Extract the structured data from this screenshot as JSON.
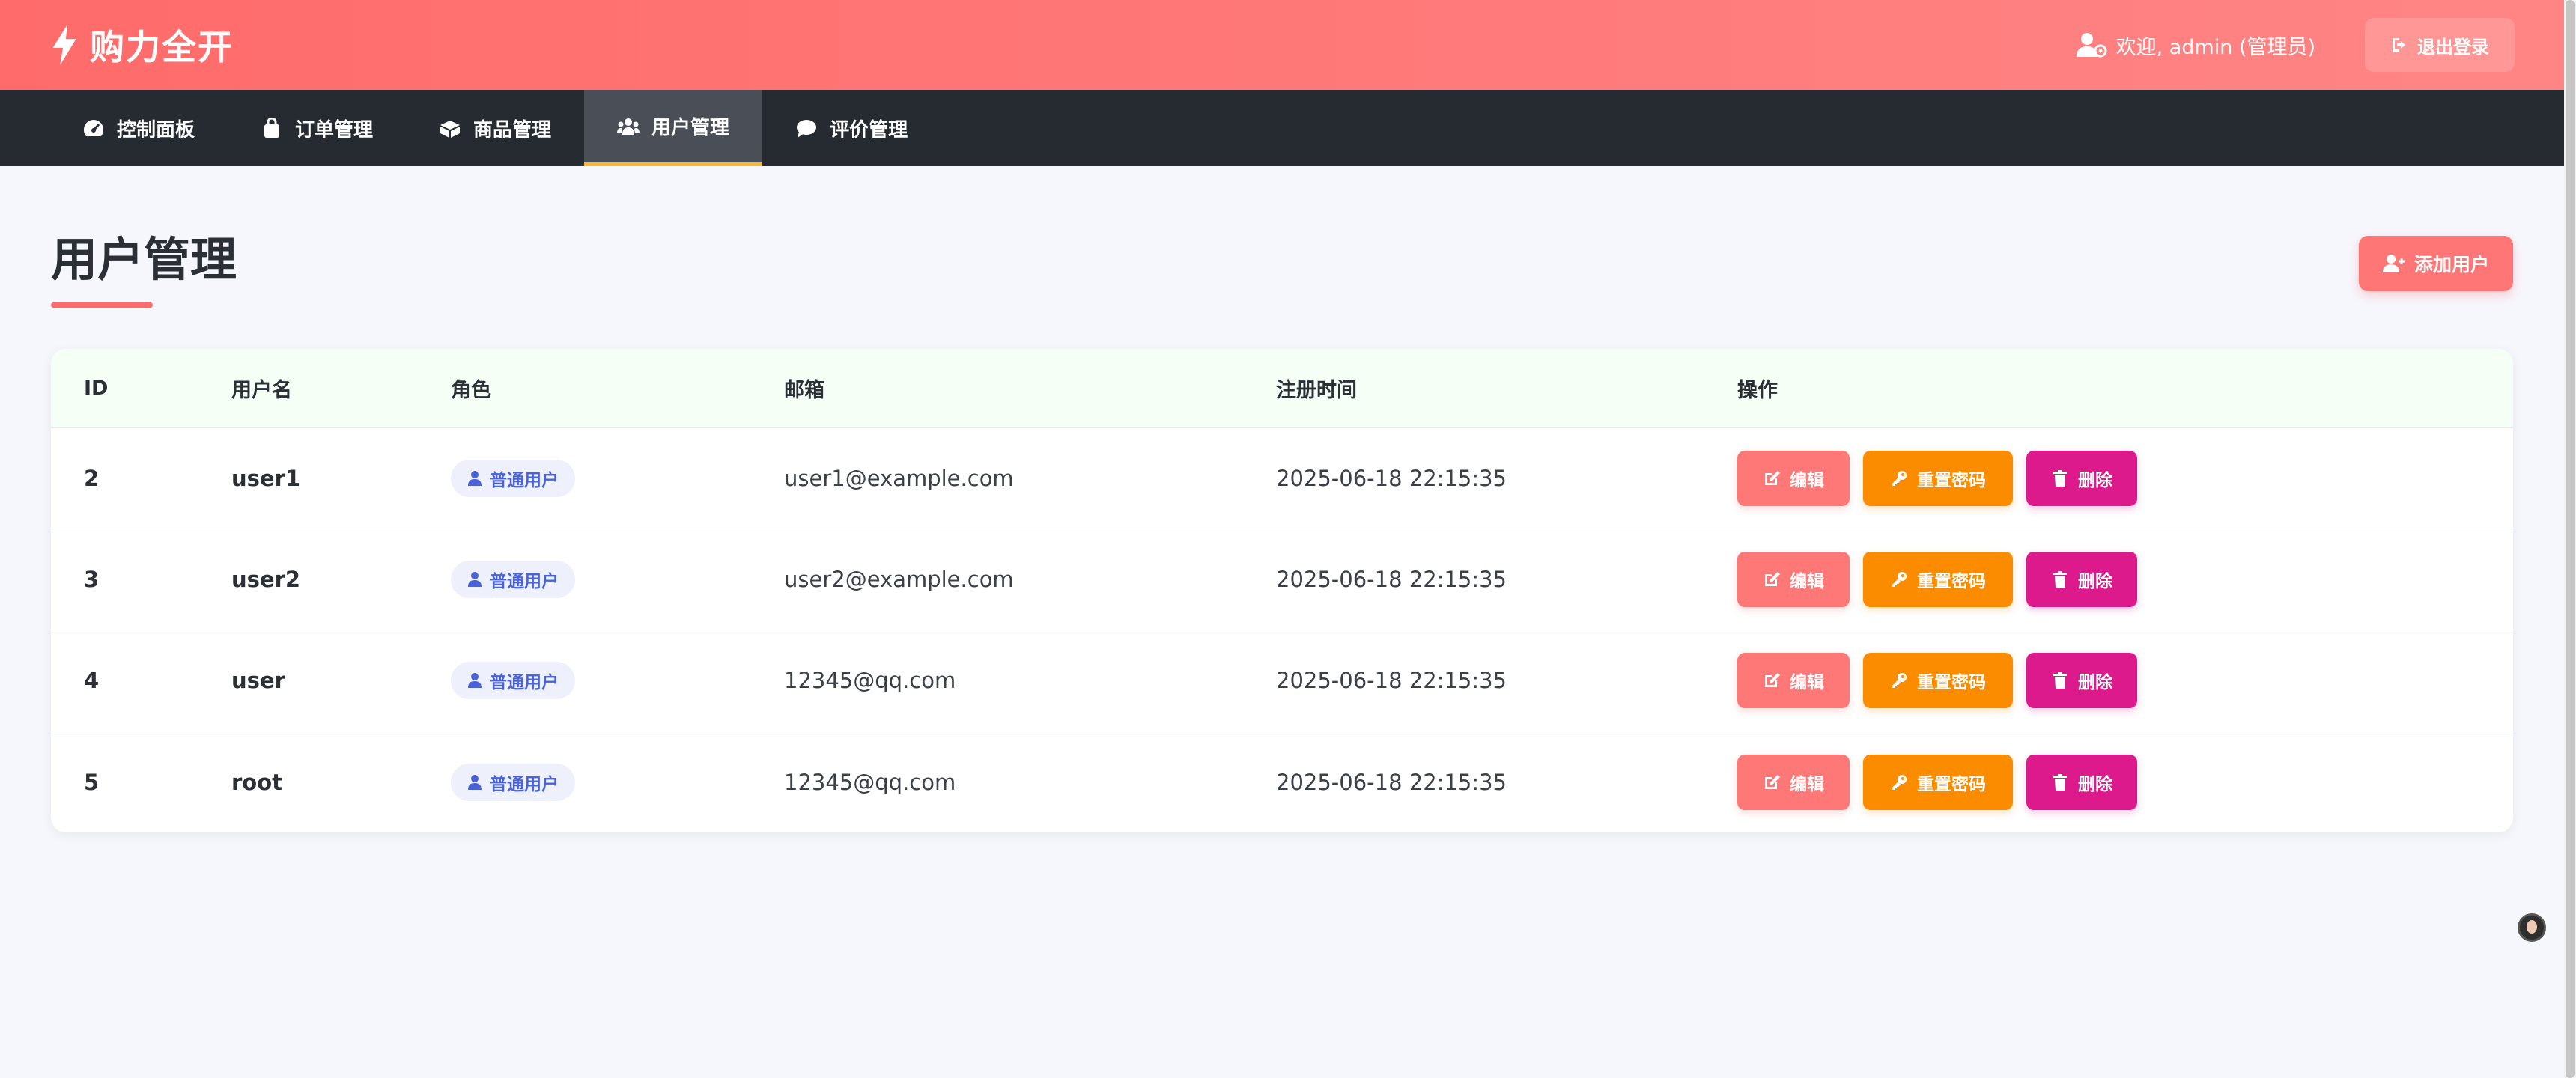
{
  "header": {
    "brand": "购力全开",
    "welcome": "欢迎, admin (管理员)",
    "logout": "退出登录"
  },
  "nav": [
    {
      "label": "控制面板",
      "icon": "dashboard-icon"
    },
    {
      "label": "订单管理",
      "icon": "shopping-bag-icon"
    },
    {
      "label": "商品管理",
      "icon": "boxes-icon"
    },
    {
      "label": "用户管理",
      "icon": "users-icon",
      "active": true
    },
    {
      "label": "评价管理",
      "icon": "comment-icon"
    }
  ],
  "page": {
    "title": "用户管理",
    "add_button": "添加用户"
  },
  "table": {
    "headers": [
      "ID",
      "用户名",
      "角色",
      "邮箱",
      "注册时间",
      "操作"
    ],
    "rows": [
      {
        "id": "2",
        "username": "user1",
        "role": "普通用户",
        "email": "user1@example.com",
        "registered": "2025-06-18 22:15:35"
      },
      {
        "id": "3",
        "username": "user2",
        "role": "普通用户",
        "email": "user2@example.com",
        "registered": "2025-06-18 22:15:35"
      },
      {
        "id": "4",
        "username": "user",
        "role": "普通用户",
        "email": "12345@qq.com",
        "registered": "2025-06-18 22:15:35"
      },
      {
        "id": "5",
        "username": "root",
        "role": "普通用户",
        "email": "12345@qq.com",
        "registered": "2025-06-18 22:15:35"
      }
    ],
    "actions": {
      "edit": "编辑",
      "reset": "重置密码",
      "delete": "删除"
    }
  },
  "colors": {
    "header_start": "#ff6b6b",
    "header_end": "#ff8585",
    "navbar": "#262b32",
    "nav_active_bar": "#f7b731",
    "edit": "#ff7878",
    "reset": "#fb8c00",
    "delete": "#dd1a8c",
    "badge_text": "#4a62d8"
  }
}
